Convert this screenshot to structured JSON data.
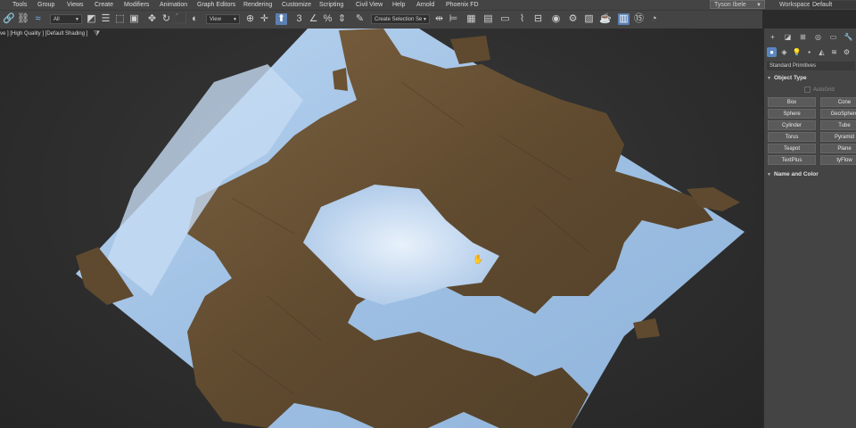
{
  "menubar": {
    "items": [
      "Tools",
      "Group",
      "Views",
      "Create",
      "Modifiers",
      "Animation",
      "Graph Editors",
      "Rendering",
      "Customize",
      "Scripting",
      "Civil View",
      "Help",
      "Arnold",
      "Phoenix FD"
    ],
    "user": "Tyson Ibele",
    "workspaces_label": "Workspaces:",
    "workspace": "Default"
  },
  "toolbar": {
    "selection_filter": "All",
    "reference_coord": "View",
    "selection_set": "Create Selection Se",
    "snap_label": "3"
  },
  "viewport": {
    "label": "ve ] [High Quality ] [Default Shading ]"
  },
  "panel": {
    "category": "Standard Primitives",
    "object_type_title": "Object Type",
    "autogrid": "AutoGrid",
    "buttons": [
      "Box",
      "Cone",
      "Sphere",
      "GeoSphere",
      "Cylinder",
      "Tube",
      "Torus",
      "Pyramid",
      "Teapot",
      "Plane",
      "TextPlus",
      "tyFlow"
    ],
    "name_color_title": "Name and Color"
  },
  "colors": {
    "ui_dark": "#444444",
    "viewport_bg": "#2e2e2e",
    "active_blue": "#5a86c0",
    "ice": "#a8c8ea",
    "rock": "#6b5232"
  }
}
